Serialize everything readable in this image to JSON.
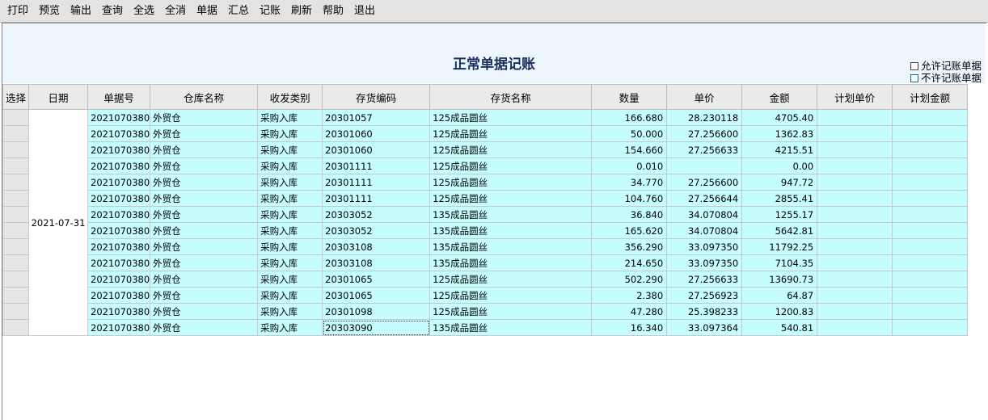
{
  "toolbar": {
    "buttons": [
      "打印",
      "预览",
      "输出",
      "查询",
      "全选",
      "全消",
      "单据",
      "汇总",
      "记账",
      "刷新",
      "帮助",
      "退出"
    ]
  },
  "page": {
    "title": "正常单据记账",
    "options": [
      "允许记账单据",
      "不许记账单据"
    ]
  },
  "table": {
    "columns": [
      "选择",
      "日期",
      "单据号",
      "仓库名称",
      "收发类别",
      "存货编码",
      "存货名称",
      "数量",
      "单价",
      "金额",
      "计划单价",
      "计划金额"
    ],
    "date": "2021-07-31",
    "rows": [
      [
        "2021070380",
        "外贸仓",
        "采购入库",
        "20301057",
        "125成品圆丝",
        "166.680",
        "28.230118",
        "4705.40",
        "",
        ""
      ],
      [
        "2021070380",
        "外贸仓",
        "采购入库",
        "20301060",
        "125成品圆丝",
        "50.000",
        "27.256600",
        "1362.83",
        "",
        ""
      ],
      [
        "2021070380",
        "外贸仓",
        "采购入库",
        "20301060",
        "125成品圆丝",
        "154.660",
        "27.256633",
        "4215.51",
        "",
        ""
      ],
      [
        "2021070380",
        "外贸仓",
        "采购入库",
        "20301111",
        "125成品圆丝",
        "0.010",
        "",
        "0.00",
        "",
        ""
      ],
      [
        "2021070380",
        "外贸仓",
        "采购入库",
        "20301111",
        "125成品圆丝",
        "34.770",
        "27.256600",
        "947.72",
        "",
        ""
      ],
      [
        "2021070380",
        "外贸仓",
        "采购入库",
        "20301111",
        "125成品圆丝",
        "104.760",
        "27.256644",
        "2855.41",
        "",
        ""
      ],
      [
        "2021070380",
        "外贸仓",
        "采购入库",
        "20303052",
        "135成品圆丝",
        "36.840",
        "34.070804",
        "1255.17",
        "",
        ""
      ],
      [
        "2021070380",
        "外贸仓",
        "采购入库",
        "20303052",
        "135成品圆丝",
        "165.620",
        "34.070804",
        "5642.81",
        "",
        ""
      ],
      [
        "2021070380",
        "外贸仓",
        "采购入库",
        "20303108",
        "135成品圆丝",
        "356.290",
        "33.097350",
        "11792.25",
        "",
        ""
      ],
      [
        "2021070380",
        "外贸仓",
        "采购入库",
        "20303108",
        "135成品圆丝",
        "214.650",
        "33.097350",
        "7104.35",
        "",
        ""
      ],
      [
        "2021070380",
        "外贸仓",
        "采购入库",
        "20301065",
        "125成品圆丝",
        "502.290",
        "27.256633",
        "13690.73",
        "",
        ""
      ],
      [
        "2021070380",
        "外贸仓",
        "采购入库",
        "20301065",
        "125成品圆丝",
        "2.380",
        "27.256923",
        "64.87",
        "",
        ""
      ],
      [
        "2021070380",
        "外贸仓",
        "采购入库",
        "20301098",
        "125成品圆丝",
        "47.280",
        "25.398233",
        "1200.83",
        "",
        ""
      ],
      [
        "2021070380",
        "外贸仓",
        "采购入库",
        "20303090",
        "135成品圆丝",
        "16.340",
        "33.097364",
        "540.81",
        "",
        ""
      ]
    ]
  },
  "colors": {
    "row_bg": "#c6feff",
    "header_bg": "#eaeaea",
    "title_color": "#1a2e5e",
    "band_bg": "#eef6fd"
  }
}
